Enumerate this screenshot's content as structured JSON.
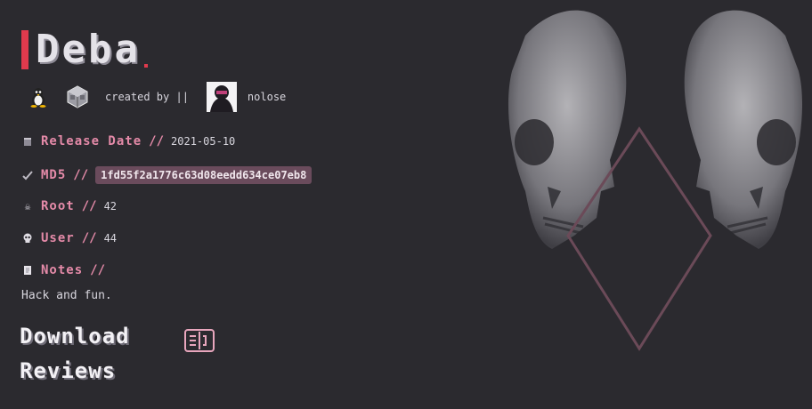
{
  "machine": {
    "title": "Deba",
    "created_by_label": "created by ||",
    "author": "nolose"
  },
  "icons": {
    "os": "linux-tux-icon",
    "platform": "virtualbox-icon",
    "release": "calendar-icon",
    "md5": "check-icon",
    "root": "skull-crossbones-icon",
    "user": "skull-icon",
    "notes": "note-icon",
    "download": "book-icon"
  },
  "fields": {
    "release": {
      "label": "Release Date",
      "sep": "//",
      "value": "2021-05-10"
    },
    "md5": {
      "label": "MD5",
      "sep": "//",
      "value": "1fd55f2a1776c63d08eedd634ce07eb8"
    },
    "root": {
      "label": "Root",
      "sep": "//",
      "value": "42"
    },
    "user": {
      "label": "User",
      "sep": "//",
      "value": "44"
    },
    "notes": {
      "label": "Notes",
      "sep": "//",
      "value": "Hack and fun."
    }
  },
  "links": {
    "download": "Download",
    "reviews": "Reviews"
  },
  "colors": {
    "background": "#2b2a2f",
    "accent": "#e03a4d",
    "label": "#e48aa8",
    "hash_bg": "#6a4b5c"
  }
}
